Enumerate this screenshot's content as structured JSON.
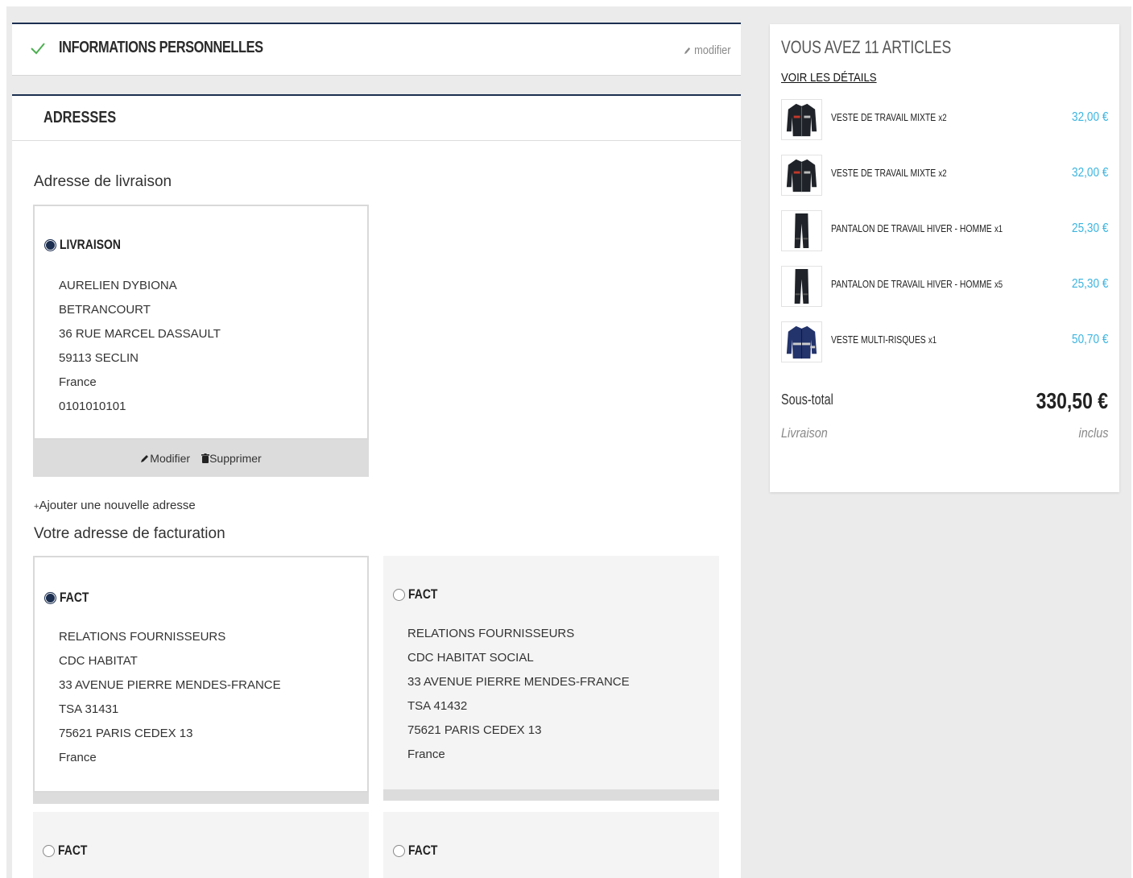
{
  "personal": {
    "title": "INFORMATIONS PERSONNELLES",
    "edit_label": "modifier"
  },
  "addresses": {
    "title": "ADRESSES",
    "delivery_title": "Adresse de livraison",
    "delivery_card": {
      "alias": "LIVRAISON",
      "selected": true,
      "lines": [
        "AURELIEN DYBIONA",
        "BETRANCOURT",
        "36 RUE MARCEL DASSAULT",
        "59113 SECLIN",
        "France",
        "0101010101"
      ],
      "edit_label": "Modifier",
      "delete_label": "Supprimer"
    },
    "add_address_label": "Ajouter une nouvelle adresse",
    "billing_title": "Votre adresse de facturation",
    "billing_cards": [
      {
        "alias": "FACT",
        "selected": true,
        "lines": [
          "RELATIONS FOURNISSEURS",
          "CDC HABITAT",
          "33 AVENUE PIERRE MENDES-FRANCE",
          "TSA 31431",
          "75621 PARIS CEDEX 13",
          "France"
        ]
      },
      {
        "alias": "FACT",
        "selected": false,
        "lines": [
          "RELATIONS FOURNISSEURS",
          "CDC HABITAT SOCIAL",
          "33 AVENUE PIERRE MENDES-FRANCE",
          "TSA 41432",
          "75621 PARIS CEDEX 13",
          "France"
        ]
      },
      {
        "alias": "FACT",
        "selected": false,
        "lines": []
      },
      {
        "alias": "FACT",
        "selected": false,
        "lines": []
      }
    ]
  },
  "cart": {
    "count_label": "VOUS AVEZ 11 ARTICLES",
    "details_label": "VOIR LES DÉTAILS",
    "items": [
      {
        "name": "VESTE DE TRAVAIL MIXTE",
        "qty": "x2",
        "price": "32,00 €",
        "thumb": "jacket"
      },
      {
        "name": "VESTE DE TRAVAIL MIXTE",
        "qty": "x2",
        "price": "32,00 €",
        "thumb": "jacket"
      },
      {
        "name": "PANTALON DE TRAVAIL HIVER - HOMME",
        "qty": "x1",
        "price": "25,30 €",
        "thumb": "pants"
      },
      {
        "name": "PANTALON DE TRAVAIL HIVER - HOMME",
        "qty": "x5",
        "price": "25,30 €",
        "thumb": "pants"
      },
      {
        "name": "VESTE MULTI-RISQUES",
        "qty": "x1",
        "price": "50,70 €",
        "thumb": "jacket-blue"
      }
    ],
    "subtotal_label": "Sous-total",
    "subtotal_value": "330,50 €",
    "shipping_label": "Livraison",
    "shipping_value": "inclus"
  },
  "colors": {
    "accent_navy": "#1c2f50",
    "price_blue": "#3ab4e0",
    "check_green": "#4caf50"
  }
}
